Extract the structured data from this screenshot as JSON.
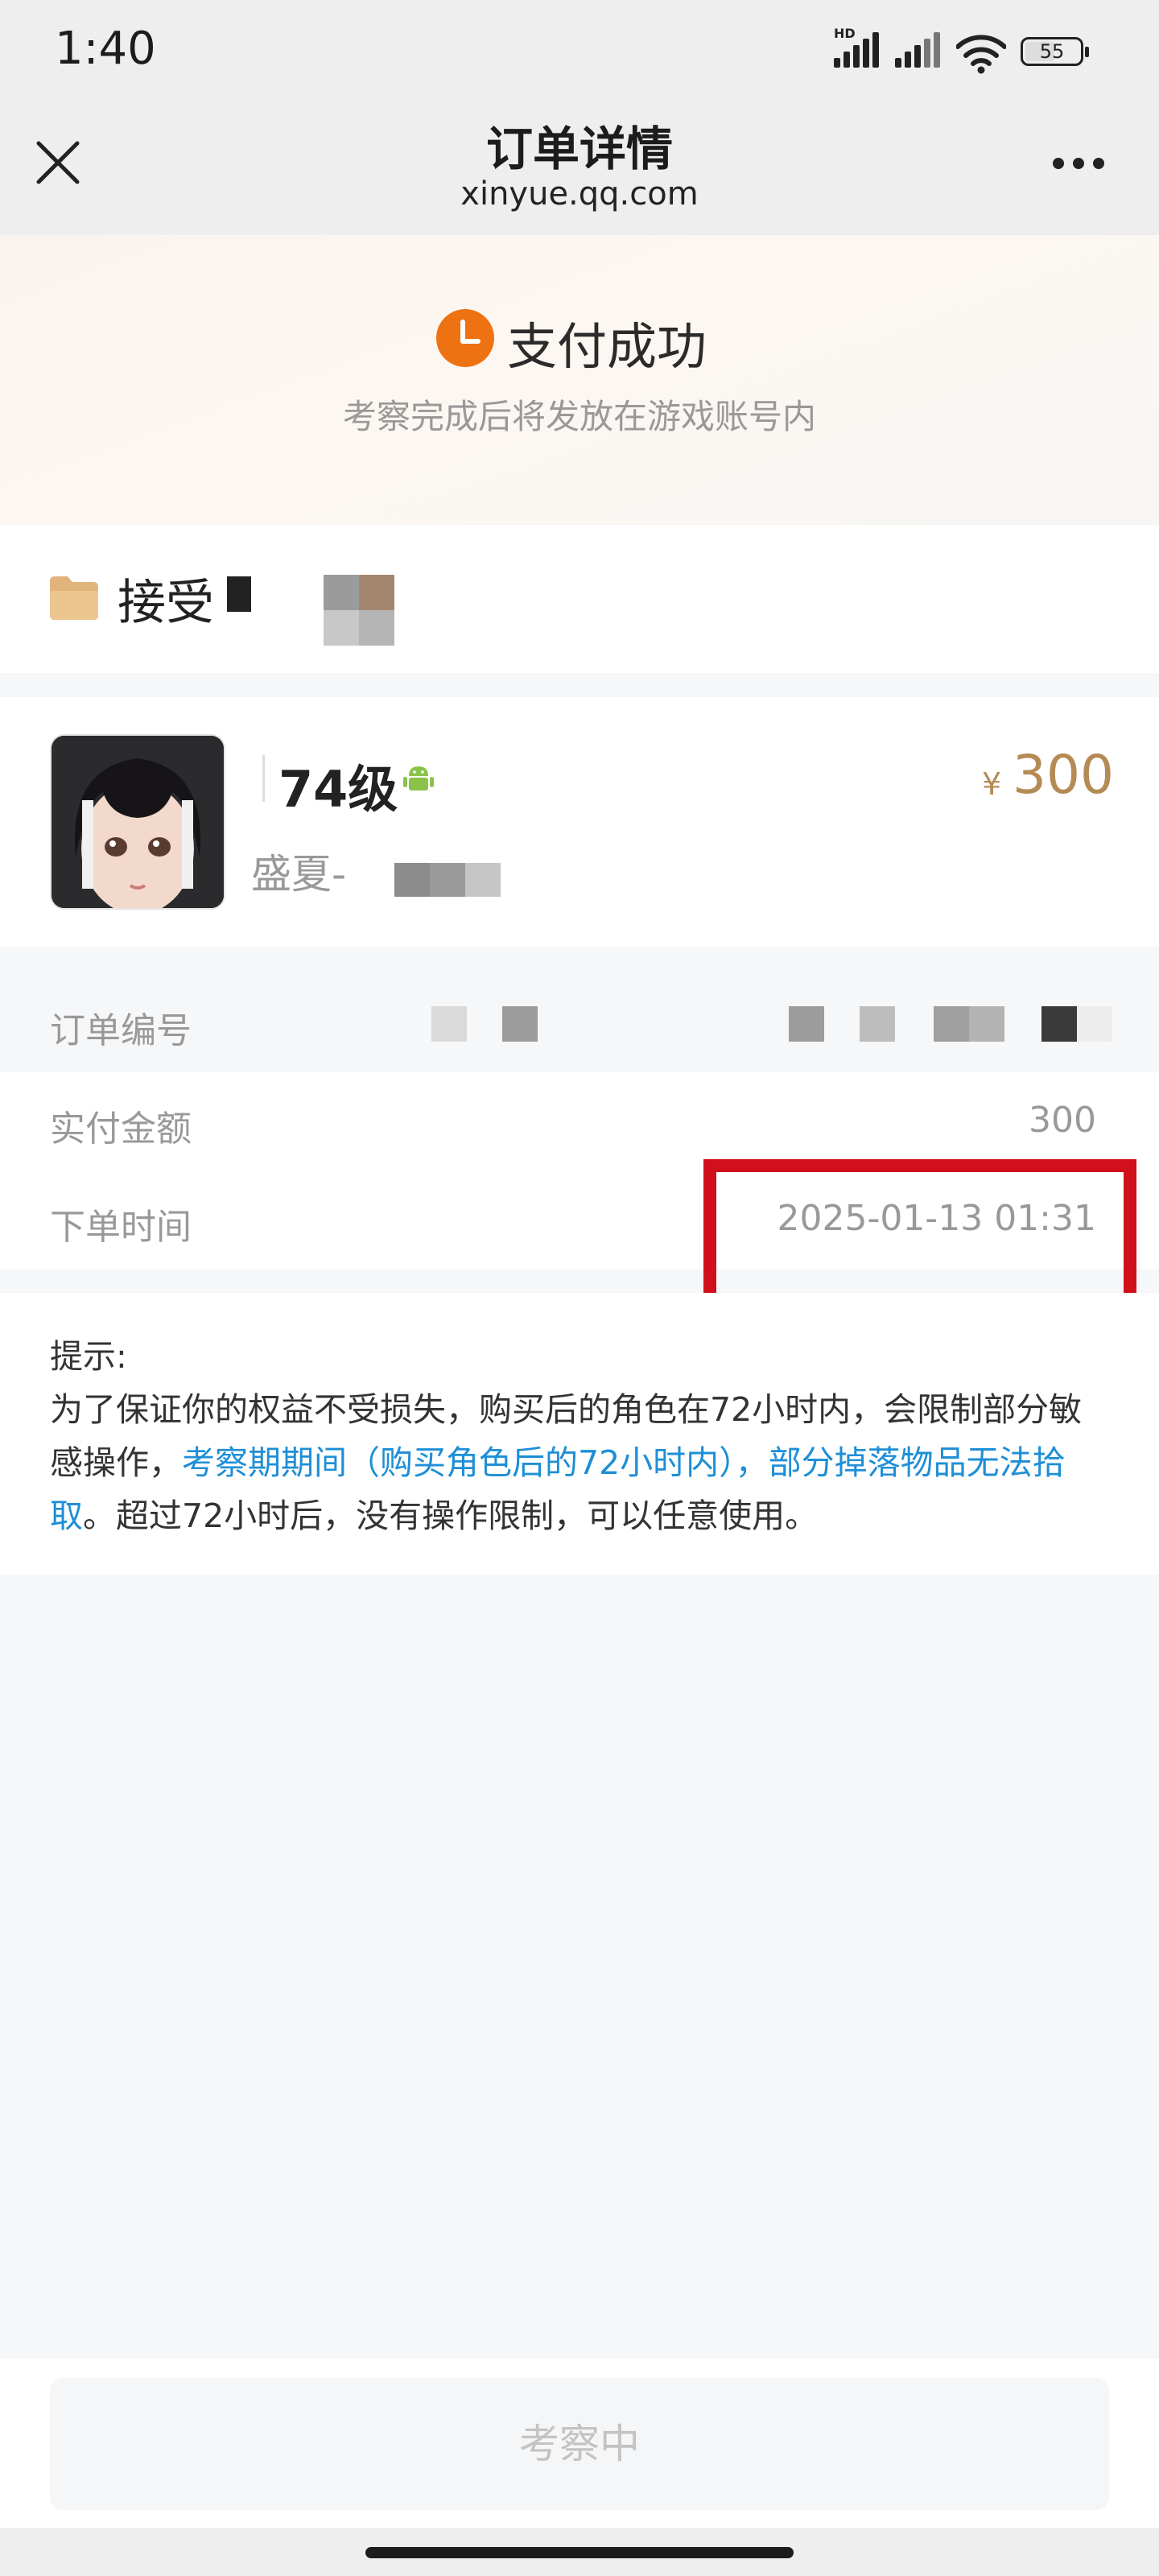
{
  "status_bar": {
    "time": "1:40",
    "signal_label": "HD",
    "battery_percent": "55",
    "battery_level": 0.55
  },
  "nav": {
    "title": "订单详情",
    "subtitle": "xinyue.qq.com"
  },
  "order_status": {
    "title": "支付成功",
    "subtitle": "考察完成后将发放在游戏账号内",
    "icon": "clock-icon",
    "accent": "#ee7212"
  },
  "seller": {
    "name": "接受",
    "icon": "folder-icon"
  },
  "product": {
    "level": "74级",
    "platform_icon": "android-icon",
    "currency": "¥",
    "price": "300",
    "role_name": "盛夏-",
    "price_color": "#b48a55"
  },
  "order_info": {
    "rows": [
      {
        "label": "订单编号",
        "value": ""
      },
      {
        "label": "实付金额",
        "value": "300"
      },
      {
        "label": "下单时间",
        "value": "2025-01-13 01:31"
      }
    ]
  },
  "tip": {
    "heading": "提示:",
    "text_1": "为了保证你的权益不受损失，购买后的角色在72小时内，会限制部分敏感操作，",
    "highlight": "考察期期间（购买角色后的72小时内），部分掉落物品无法拾取",
    "text_2": "。超过72小时后，没有操作限制，可以任意使用。",
    "highlight_color": "#1e8fd6"
  },
  "bottom_button": {
    "label": "考察中"
  },
  "annotation": {
    "color": "#d0111b"
  }
}
